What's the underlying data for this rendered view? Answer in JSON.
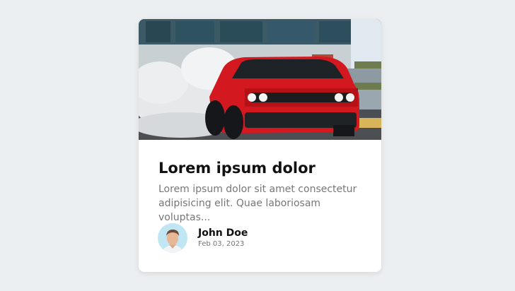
{
  "card": {
    "title": "Lorem ipsum dolor",
    "text": "Lorem ipsum dolor sit amet consectetur adipisicing elit. Quae laboriosam voluptas...",
    "image": "red-muscle-car-burnout-photo",
    "author": {
      "name": "John Doe",
      "date": "Feb 03, 2023",
      "avatar": "man-portrait-photo"
    }
  }
}
